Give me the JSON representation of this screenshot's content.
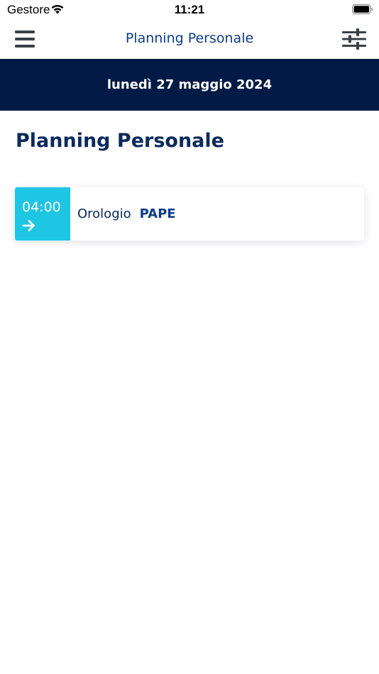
{
  "status_bar": {
    "carrier": "Gestore",
    "time": "11:21",
    "wifi_icon": "wifi-icon",
    "battery_icon": "battery-icon"
  },
  "nav": {
    "title": "Planning Personale",
    "menu_icon": "hamburger-menu-icon",
    "filter_icon": "sliders-filter-icon"
  },
  "date_banner": {
    "date": "lunedì 27 maggio 2024"
  },
  "main": {
    "heading": "Planning Personale",
    "entries": [
      {
        "time": "04:00",
        "arrow_icon": "arrow-right-icon",
        "label": "Orologio",
        "value": "PAPE"
      }
    ]
  },
  "colors": {
    "nav_title": "#0b3c8c",
    "banner_bg": "#021a45",
    "heading": "#0a2a5e",
    "time_block_bg": "#1ec6e4",
    "icon_gray": "#3a4048"
  }
}
